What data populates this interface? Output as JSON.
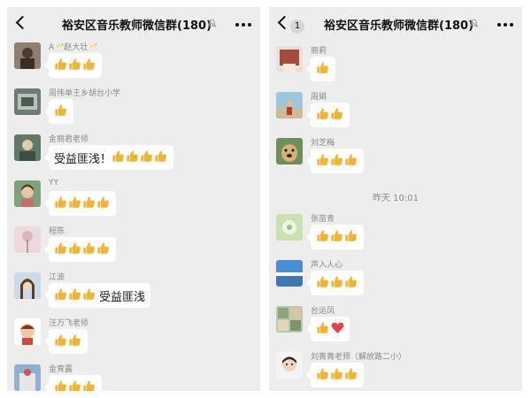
{
  "left_panel": {
    "title": "裕安区音乐教师微信群(180)",
    "messages": [
      {
        "sender": "A🥂赵大壮🥂",
        "text": "",
        "thumbs": 3
      },
      {
        "sender": "周伟单王乡胡台小学",
        "text": "",
        "thumbs": 1
      },
      {
        "sender": "金丽君老师",
        "text": "受益匪浅！",
        "thumbs": 4
      },
      {
        "sender": "YY",
        "text": "",
        "thumbs": 4
      },
      {
        "sender": "程陈",
        "text": "",
        "thumbs": 4
      },
      {
        "sender": "江波",
        "text_after": "受益匪浅",
        "thumbs": 3
      },
      {
        "sender": "汪万飞老师",
        "text": "",
        "thumbs": 2
      },
      {
        "sender": "金育露",
        "text": "",
        "thumbs": 3
      }
    ]
  },
  "right_panel": {
    "title": "裕安区音乐教师微信群(180)",
    "unread_count": "1",
    "messages_before": [
      {
        "sender": "丽莉",
        "thumbs": 1
      },
      {
        "sender": "周娟",
        "thumbs": 2
      },
      {
        "sender": "刘芝梅",
        "thumbs": 3
      }
    ],
    "time_divider": "昨天 10:01",
    "messages_after": [
      {
        "sender": "张苗青",
        "thumbs": 3
      },
      {
        "sender": "声入人心",
        "thumbs": 3
      },
      {
        "sender": "台运凤",
        "thumbs": 1,
        "heart": true
      },
      {
        "sender": "刘菁菁老师（解放路二小）",
        "thumbs": 3
      }
    ]
  },
  "colors": {
    "background": "#ededed",
    "bubble": "#ffffff",
    "thumb": "#f2b430",
    "heart": "#e8404a"
  }
}
